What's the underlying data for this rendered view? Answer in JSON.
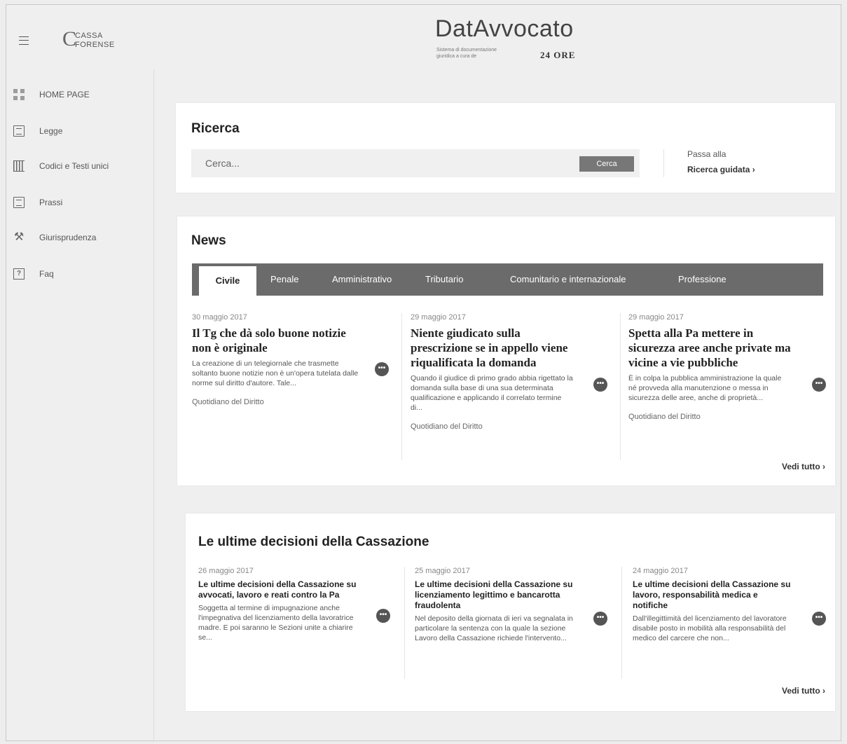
{
  "header": {
    "logo_mark": "C",
    "logo_line1": "CASSA",
    "logo_line2": "FORENSE",
    "brand_name": "DatAvvocato",
    "brand_sub": "Sistema di documentazione giuridica a cura de",
    "brand_partner": "24 ORE"
  },
  "sidebar": {
    "items": [
      {
        "label": "HOME PAGE",
        "icon": "grid-icon"
      },
      {
        "label": "Legge",
        "icon": "document-icon"
      },
      {
        "label": "Codici e Testi unici",
        "icon": "books-icon"
      },
      {
        "label": "Prassi",
        "icon": "document-icon"
      },
      {
        "label": "Giurisprudenza",
        "icon": "gavel-icon"
      },
      {
        "label": "Faq",
        "icon": "faq-icon"
      }
    ]
  },
  "search": {
    "title": "Ricerca",
    "placeholder": "Cerca...",
    "button": "Cerca",
    "guided_pre": "Passa alla",
    "guided_link": "Ricerca guidata ›"
  },
  "news": {
    "title": "News",
    "tabs": [
      "Civile",
      "Penale",
      "Amministrativo",
      "Tributario",
      "Comunitario e internazionale",
      "Professione"
    ],
    "articles": [
      {
        "date": "30 maggio 2017",
        "title": "Il Tg che dà solo buone notizie non è originale",
        "excerpt": "La creazione di un telegiornale che trasmette soltanto buone notizie non è un'opera tutelata dalle norme sul diritto d'autore. Tale...",
        "source": "Quotidiano del Diritto"
      },
      {
        "date": "29 maggio 2017",
        "title": "Niente giudicato sulla prescrizione se in appello viene riqualificata la domanda",
        "excerpt": "Quando il giudice di primo grado abbia rigettato la domanda sulla base di una sua determinata qualificazione e applicando il correlato termine di...",
        "source": "Quotidiano del Diritto"
      },
      {
        "date": "29 maggio 2017",
        "title": "Spetta alla Pa mettere in sicurezza aree anche private ma vicine a vie pubbliche",
        "excerpt": "È in colpa la pubblica amministrazione la quale né provveda alla manutenzione o messa in sicurezza delle aree, anche di proprietà...",
        "source": "Quotidiano del Diritto"
      }
    ],
    "view_all": "Vedi tutto ›"
  },
  "cassazione": {
    "title": "Le ultime decisioni della Cassazione",
    "items": [
      {
        "date": "26 maggio 2017",
        "title": "Le ultime decisioni della Cassazione su avvocati, lavoro e reati contro la Pa",
        "excerpt": "Soggetta al termine di impugnazione anche l'impegnativa del licenziamento della lavoratrice madre. E poi saranno le Sezioni unite a chiarire se..."
      },
      {
        "date": "25 maggio 2017",
        "title": "Le ultime decisioni della Cassazione su licenziamento legittimo e bancarotta fraudolenta",
        "excerpt": "Nel deposito della giornata di ieri va segnalata in particolare la sentenza con la quale la sezione Lavoro della Cassazione richiede l'intervento..."
      },
      {
        "date": "24 maggio 2017",
        "title": "Le ultime decisioni della Cassazione su lavoro, responsabilità medica e notifiche",
        "excerpt": "Dall'illegittimità del licenziamento del lavoratore disabile posto in mobilità alla responsabilità del medico del carcere che non..."
      }
    ],
    "view_all": "Vedi tutto ›"
  },
  "more_glyph": "•••"
}
